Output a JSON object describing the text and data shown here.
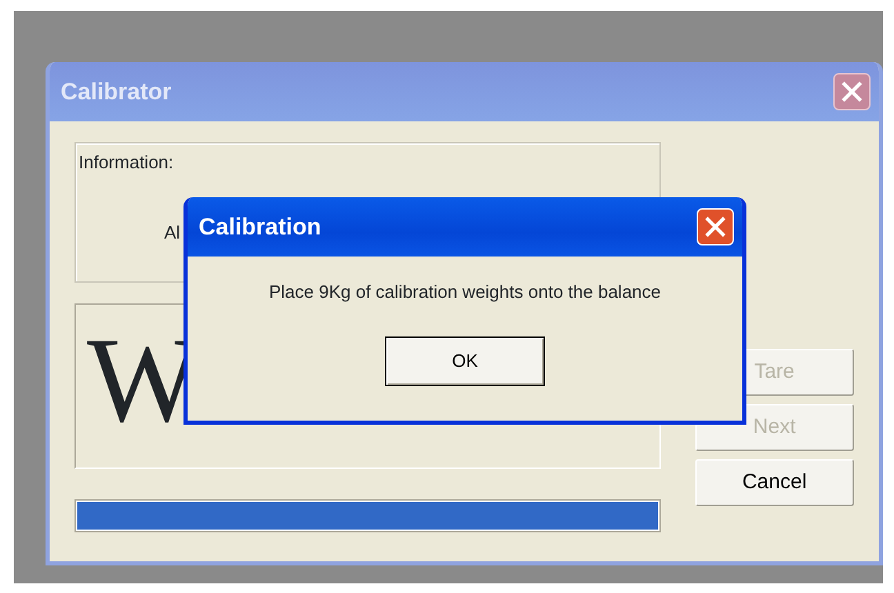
{
  "window": {
    "title": "Calibrator",
    "active": false
  },
  "information": {
    "label": "Information:",
    "text": "Al"
  },
  "weight_display": {
    "text": "W"
  },
  "progress": {
    "level": 1
  },
  "buttons": [
    {
      "label": "Tare",
      "disabled": true
    },
    {
      "label": "Next",
      "disabled": true
    },
    {
      "label": "Cancel",
      "disabled": false
    }
  ],
  "dialog": {
    "title": "Calibration",
    "active": true,
    "message": "Place 9Kg of calibration weights onto the balance",
    "buttons": [
      "OK"
    ]
  }
}
